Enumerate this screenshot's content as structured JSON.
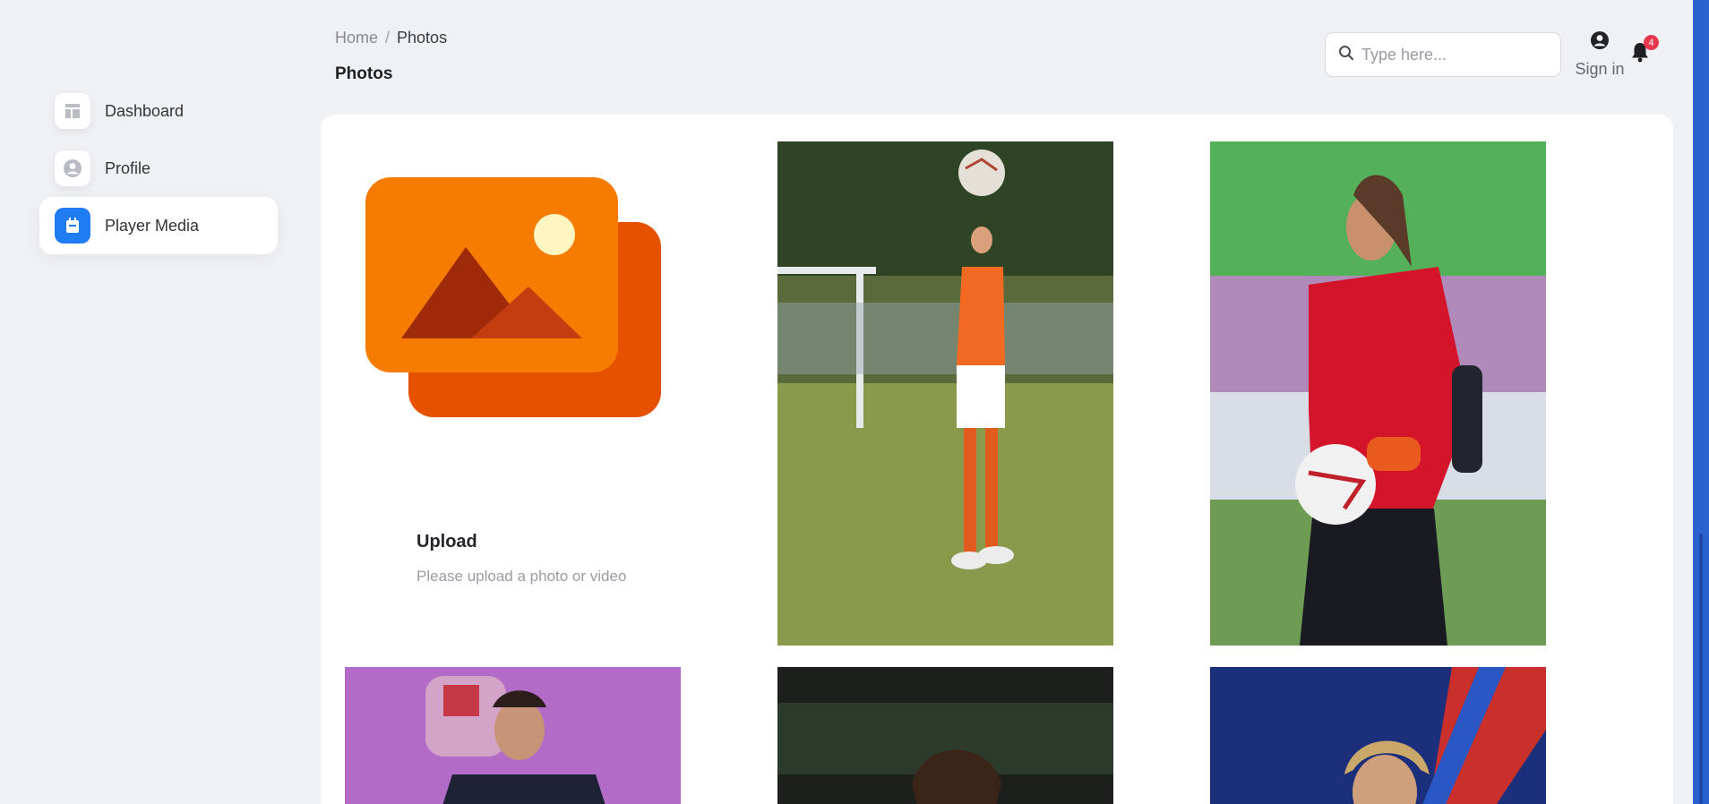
{
  "sidebar": {
    "items": [
      {
        "label": "Dashboard",
        "icon": "dashboard-icon"
      },
      {
        "label": "Profile",
        "icon": "profile-icon"
      },
      {
        "label": "Player Media",
        "icon": "calendar-icon",
        "active": true
      }
    ]
  },
  "header": {
    "breadcrumb": {
      "home": "Home",
      "separator": "/",
      "current": "Photos"
    },
    "title": "Photos",
    "search": {
      "placeholder": "Type here...",
      "value": ""
    },
    "signin_label": "Sign in",
    "notification_count": "4"
  },
  "upload": {
    "title": "Upload",
    "description": "Please upload a photo or video"
  },
  "colors": {
    "accent": "#1f7cf2",
    "badge": "#e8384f",
    "upload_front": "#f57c00",
    "upload_back": "#e65100"
  }
}
